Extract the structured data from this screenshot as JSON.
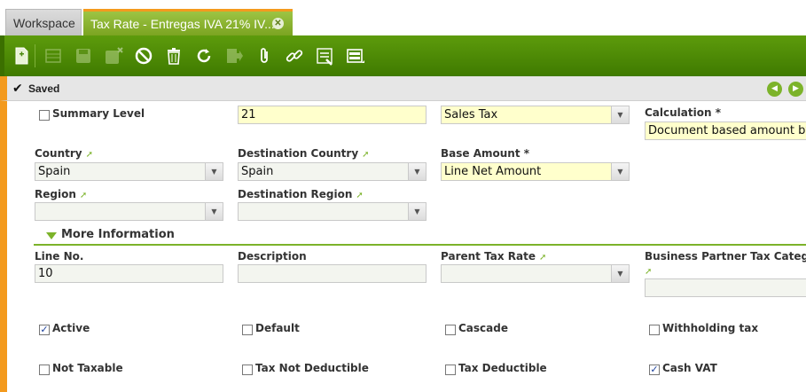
{
  "tabs": {
    "workspace": "Workspace",
    "active": "Tax Rate - Entregas IVA 21% IV...",
    "close_icon": "close-icon"
  },
  "toolbar": {
    "buttons": [
      "new-record-icon",
      "grid-view-icon",
      "save-icon",
      "save-close-icon",
      "undo-icon",
      "delete-icon",
      "refresh-icon",
      "export-icon",
      "attachment-icon",
      "link-icon",
      "tools-icon",
      "toggle-view-icon"
    ]
  },
  "status": {
    "text": "Saved"
  },
  "form": {
    "summary_level": {
      "label": "Summary Level",
      "checked": false
    },
    "rate": {
      "value": "21"
    },
    "tax_type": {
      "value": "Sales Tax"
    },
    "calculation": {
      "label": "Calculation *",
      "value": "Document based amount by r"
    },
    "country": {
      "label": "Country",
      "value": "Spain"
    },
    "dest_country": {
      "label": "Destination Country",
      "value": "Spain"
    },
    "base_amount": {
      "label": "Base Amount *",
      "value": "Line Net Amount"
    },
    "region": {
      "label": "Region",
      "value": ""
    },
    "dest_region": {
      "label": "Destination Region",
      "value": ""
    },
    "section_title": "More Information",
    "line_no": {
      "label": "Line No.",
      "value": "10"
    },
    "description": {
      "label": "Description",
      "value": ""
    },
    "parent_tax_rate": {
      "label": "Parent Tax Rate",
      "value": ""
    },
    "bp_tax_category": {
      "label": "Business Partner Tax Categ",
      "value": ""
    },
    "active": {
      "label": "Active",
      "checked": true
    },
    "default": {
      "label": "Default",
      "checked": false
    },
    "cascade": {
      "label": "Cascade",
      "checked": false
    },
    "withholding_tax": {
      "label": "Withholding tax",
      "checked": false
    },
    "not_taxable": {
      "label": "Not Taxable",
      "checked": false
    },
    "tax_not_deductible": {
      "label": "Tax Not Deductible",
      "checked": false
    },
    "tax_deductible": {
      "label": "Tax Deductible",
      "checked": false
    },
    "cash_vat": {
      "label": "Cash VAT",
      "checked": true
    }
  }
}
